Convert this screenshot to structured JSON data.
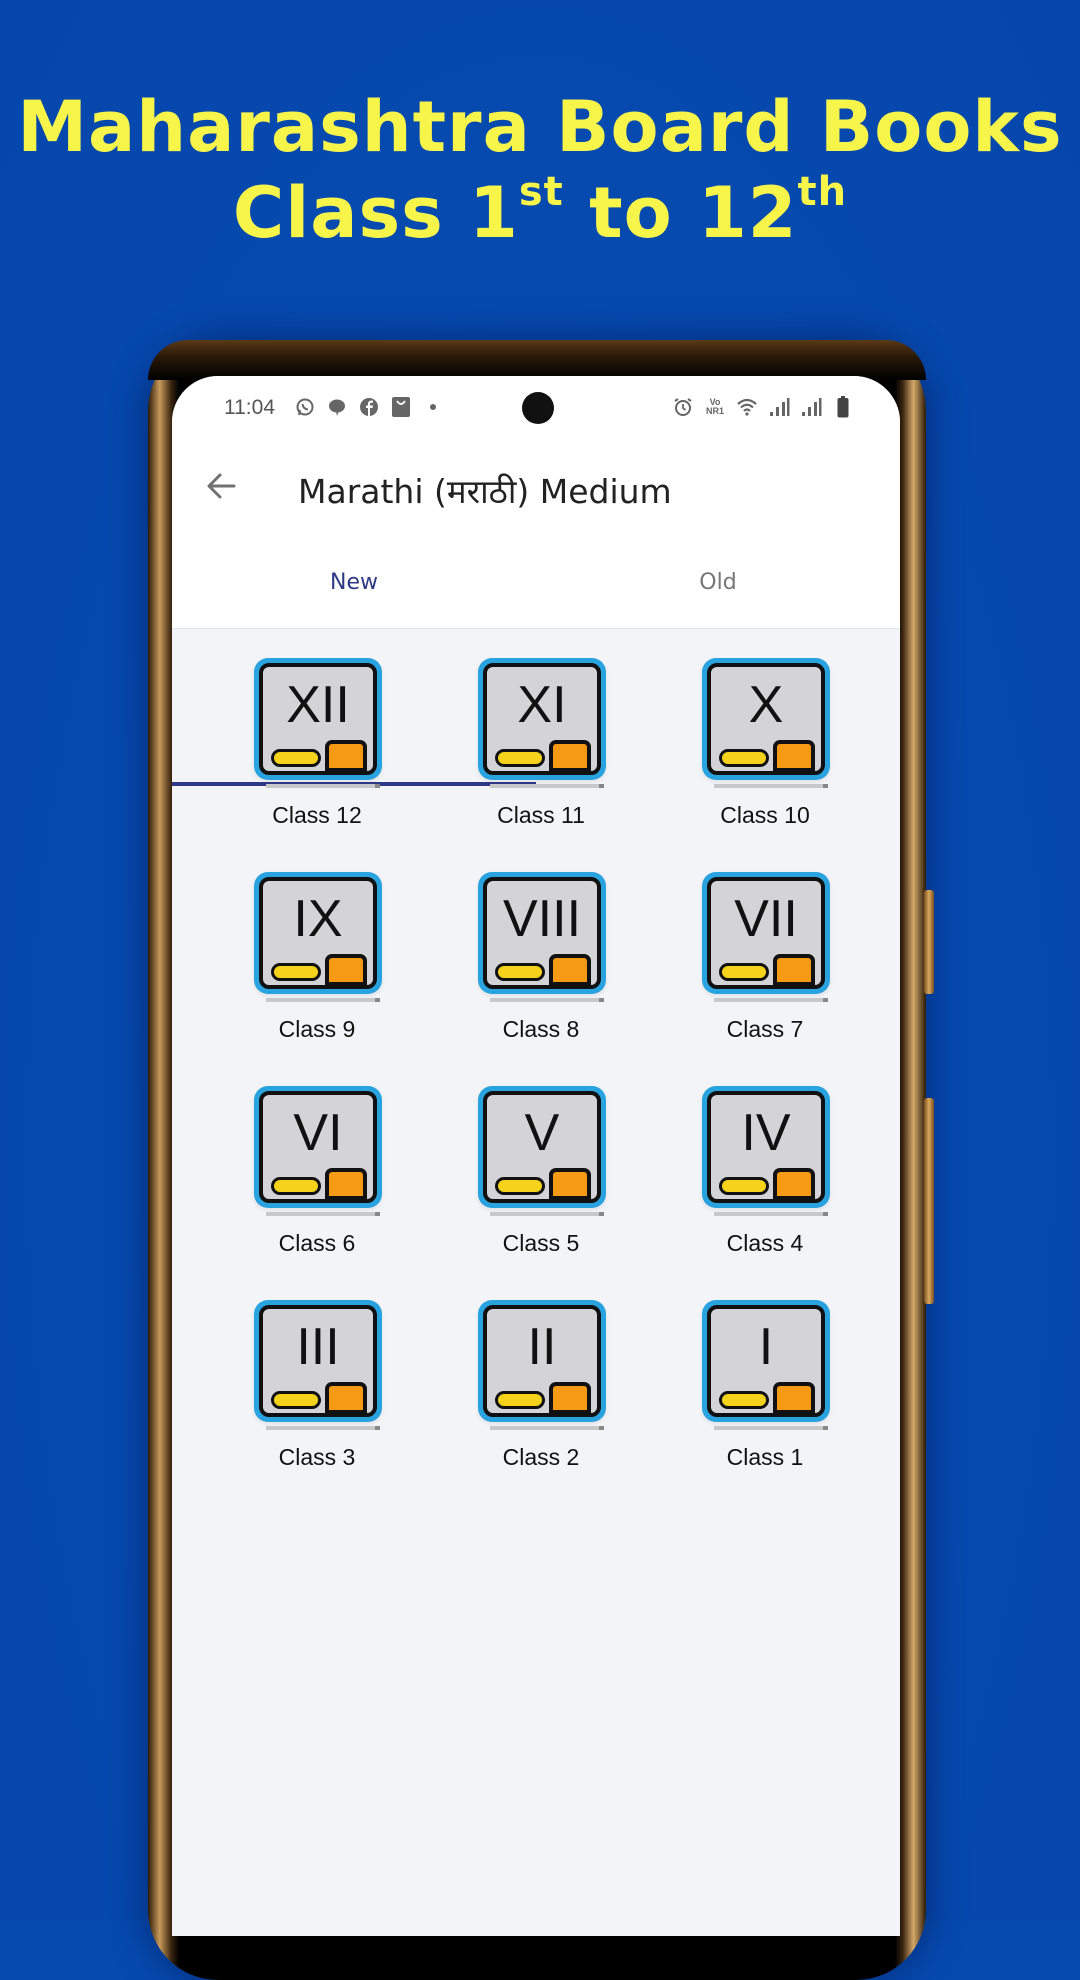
{
  "promo": {
    "headline_line1": "Maharashtra Board Books",
    "headline_line2_prefix": "Class 1",
    "headline_line2_sup1": "st",
    "headline_line2_mid": " to 12",
    "headline_line2_sup2": "th",
    "background_color": "#064ab0",
    "text_color": "#f7f54a"
  },
  "status_bar": {
    "time": "11:04",
    "left_icons": [
      "whatsapp-icon",
      "chat-bubble-icon",
      "facebook-icon",
      "shopping-bag-icon",
      "dot-icon"
    ],
    "right_icons": [
      "alarm-icon",
      "volte-nr-icon",
      "wifi-icon",
      "signal-icon",
      "signal-icon",
      "battery-icon"
    ],
    "volte_label": "Vo NR1"
  },
  "app_bar": {
    "title": "Marathi (मराठी) Medium",
    "back_icon": "arrow-left-icon"
  },
  "tabs": [
    {
      "label": "New",
      "selected": true
    },
    {
      "label": "Old",
      "selected": false
    }
  ],
  "accent_color": "#2e3a85",
  "classes": [
    {
      "numeral": "XII",
      "label": "Class 12"
    },
    {
      "numeral": "XI",
      "label": "Class 11"
    },
    {
      "numeral": "X",
      "label": "Class 10"
    },
    {
      "numeral": "IX",
      "label": "Class 9"
    },
    {
      "numeral": "VIII",
      "label": "Class 8"
    },
    {
      "numeral": "VII",
      "label": "Class 7"
    },
    {
      "numeral": "VI",
      "label": "Class 6"
    },
    {
      "numeral": "V",
      "label": "Class 5"
    },
    {
      "numeral": "IV",
      "label": "Class 4"
    },
    {
      "numeral": "III",
      "label": "Class 3"
    },
    {
      "numeral": "II",
      "label": "Class 2"
    },
    {
      "numeral": "I",
      "label": "Class 1"
    }
  ]
}
